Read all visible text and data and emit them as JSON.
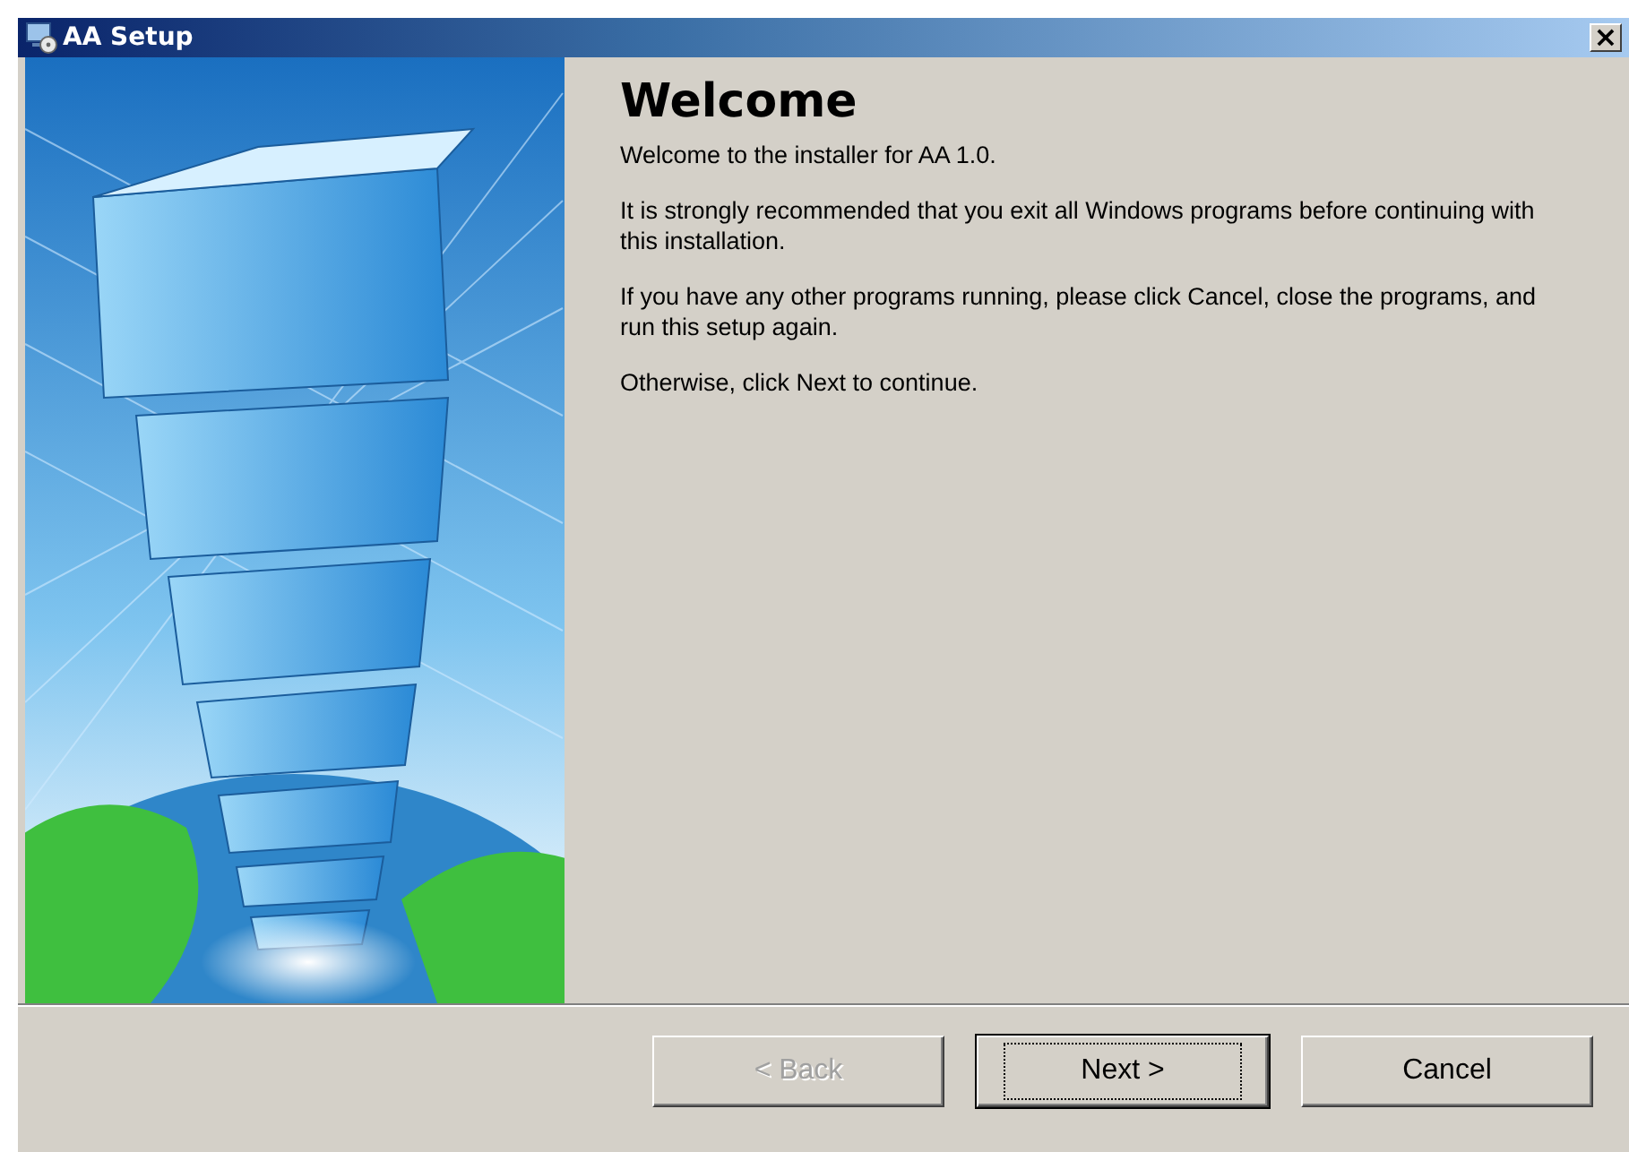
{
  "window": {
    "title": "AA Setup",
    "close": "×"
  },
  "heading": "Welcome",
  "paragraphs": [
    "Welcome to the installer for AA 1.0.",
    "It is strongly recommended that you exit all Windows programs before continuing with this installation.",
    "If you have any other programs running, please click Cancel, close the programs, and run this setup again.",
    "Otherwise, click Next to continue."
  ],
  "buttons": [
    {
      "label": "< Back",
      "disabled": true,
      "default": false
    },
    {
      "label": "Next >",
      "disabled": false,
      "default": true
    },
    {
      "label": "Cancel",
      "disabled": false,
      "default": false
    }
  ]
}
